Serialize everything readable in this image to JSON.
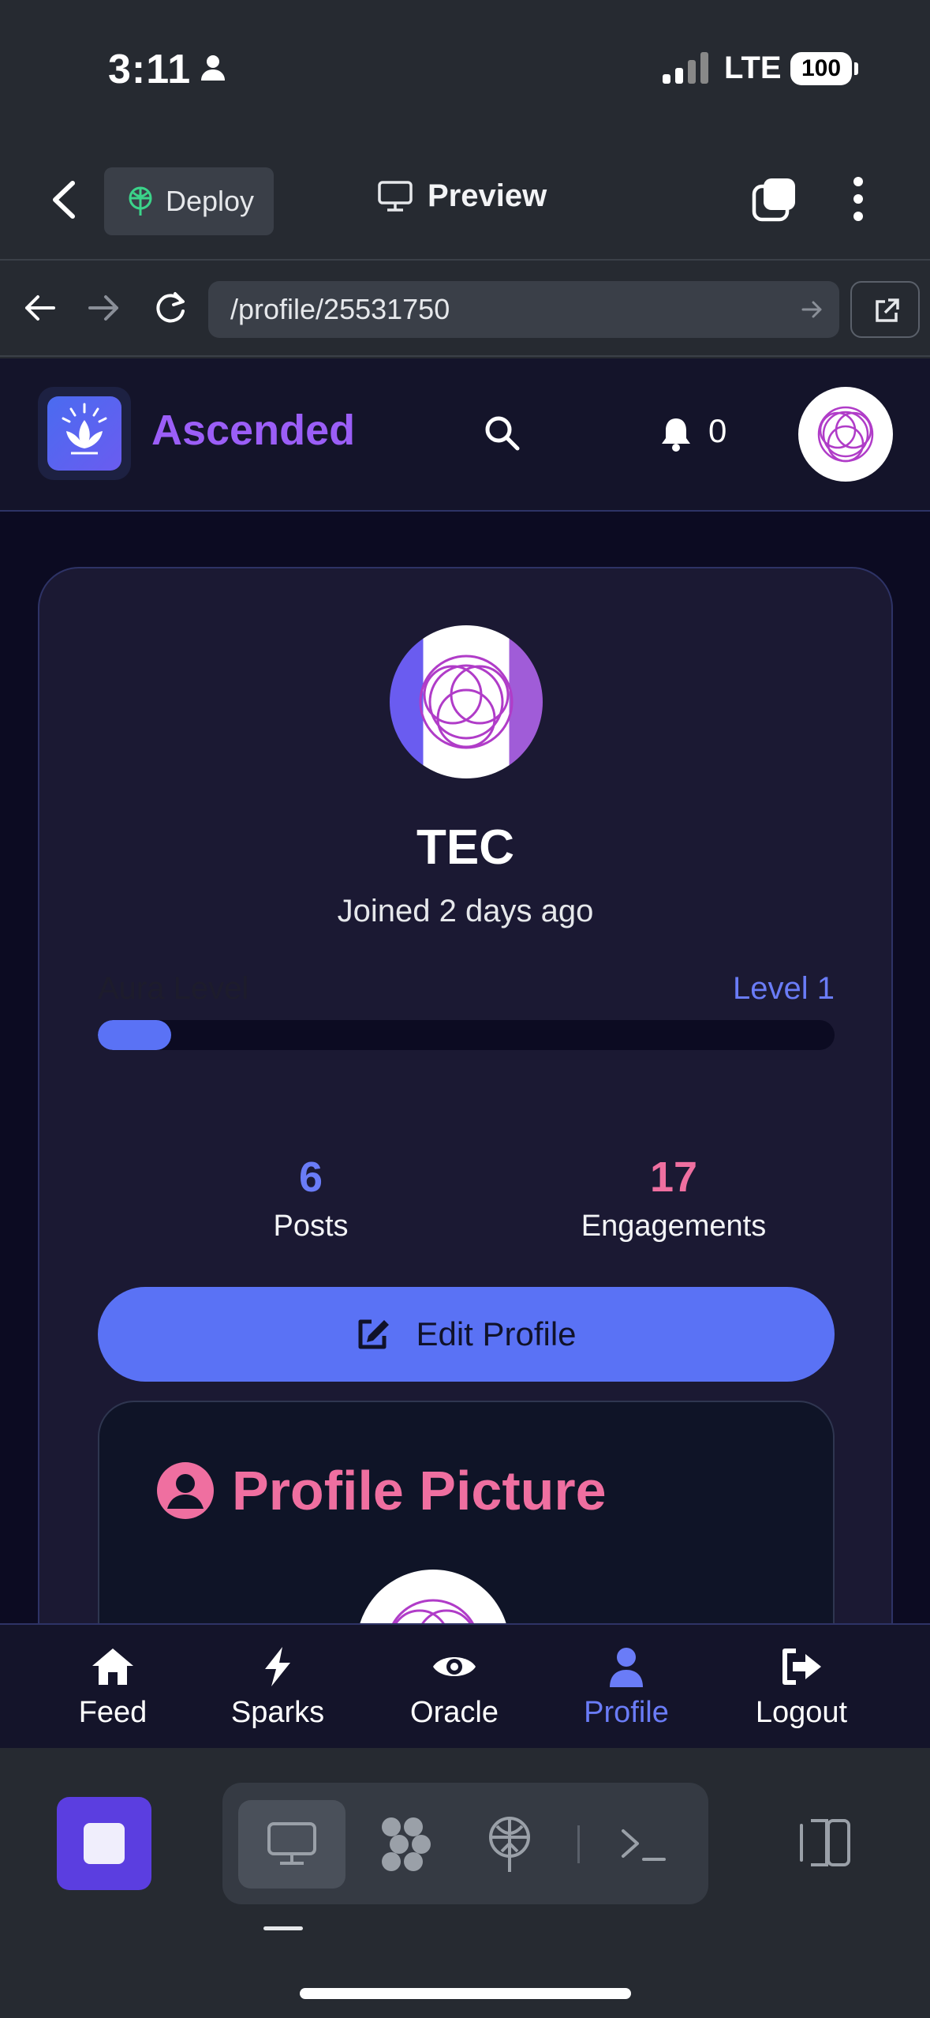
{
  "status_bar": {
    "time": "3:11",
    "network": "LTE",
    "battery": "100"
  },
  "toolbar": {
    "deploy_label": "Deploy",
    "preview_label": "Preview"
  },
  "url_bar": {
    "url": "/profile/25531750"
  },
  "app": {
    "name": "Ascended",
    "notification_count": "0"
  },
  "profile": {
    "username": "TEC",
    "joined": "Joined 2 days ago",
    "aura_label": "Aura Level",
    "aura_level": "Level 1",
    "aura_progress": 0.1,
    "stats": [
      {
        "value": "6",
        "label": "Posts",
        "color": "#6a7cf7"
      },
      {
        "value": "17",
        "label": "Engagements",
        "color": "#ef6fa0"
      }
    ],
    "edit_label": "Edit Profile",
    "picture_section_title": "Profile Picture"
  },
  "bottom_nav": {
    "items": [
      {
        "label": "Feed",
        "icon": "home-icon"
      },
      {
        "label": "Sparks",
        "icon": "bolt-icon"
      },
      {
        "label": "Oracle",
        "icon": "eye-icon"
      },
      {
        "label": "Profile",
        "icon": "user-icon",
        "active": true
      },
      {
        "label": "Logout",
        "icon": "logout-icon"
      }
    ]
  },
  "colors": {
    "accent": "#5a72f5",
    "brand": "#9b5ef7",
    "pink": "#ef6fa0",
    "active_nav": "#6a7cf7"
  }
}
